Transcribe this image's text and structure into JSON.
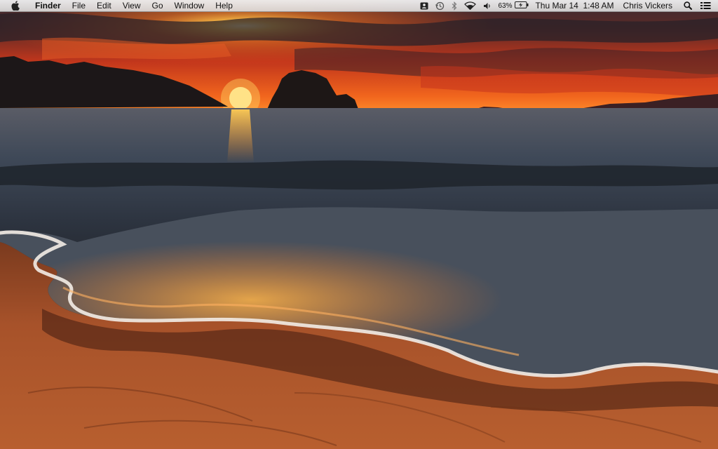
{
  "menubar": {
    "apple_icon": "apple-icon",
    "app_name": "Finder",
    "menus": [
      "File",
      "Edit",
      "View",
      "Go",
      "Window",
      "Help"
    ],
    "status": {
      "icons": [
        "contacts-icon",
        "time-machine-icon",
        "bluetooth-icon",
        "wifi-icon",
        "volume-icon"
      ],
      "battery_percent": "63%",
      "battery_icon": "battery-charging-icon",
      "clock": "Thu Mar 14  1:48 AM",
      "user_name": "Chris Vickers",
      "spotlight_icon": "spotlight-search-icon",
      "notification_icon": "notification-center-icon"
    }
  },
  "desktop": {
    "wallpaper": "sunset-beach-wallpaper"
  },
  "colors": {
    "menubar_bg": "#ececec",
    "sky_orange": "#e8501a",
    "sun": "#ffd45a",
    "sand": "#a9532a",
    "sea": "#3a4250"
  }
}
